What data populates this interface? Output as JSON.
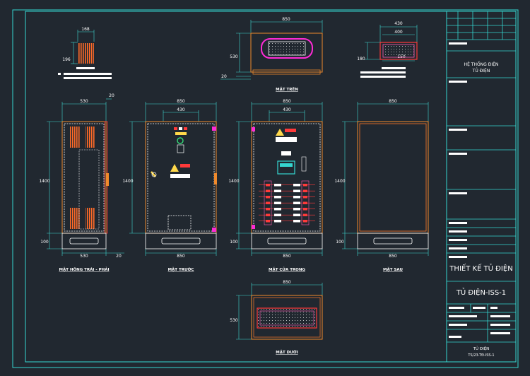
{
  "colors": {
    "background": "#212830",
    "frame": "#35d6d0",
    "dimension": "#3fd9d2",
    "cabinet": "#f08a2c",
    "panel": "#ff7a28",
    "red": "#ff3a3a",
    "magenta": "#ff2bd6",
    "white": "#ffffff",
    "yellow": "#ffd84a",
    "green": "#35e07a",
    "accent_pink": "#ff5fb3"
  },
  "views": {
    "side": {
      "title": "MẶT HÔNG TRÁI - PHẢI",
      "w_top": "530",
      "w_bottom": "530",
      "gap_top": "20",
      "gap_bottom": "20",
      "h": "1400",
      "base": "100"
    },
    "front": {
      "title": "MẶT TRƯỚC",
      "w": "850",
      "inner_w": "430",
      "w_bottom": "850",
      "h": "1400",
      "base": "100"
    },
    "inside": {
      "title": "MẶT CỬA TRONG",
      "w": "850",
      "inner_w": "430",
      "w_bottom": "850",
      "h": "1400",
      "base": "100"
    },
    "back": {
      "title": "MẶT SAU",
      "w": "850",
      "w_bottom": "850",
      "h": "1400",
      "base": "100"
    },
    "top": {
      "title": "MẶT TRÊN",
      "w": "850",
      "h": "530",
      "gap": "20"
    },
    "bottom": {
      "title": "MẶT DƯỚI",
      "w": "850",
      "h": "530"
    },
    "vent": {
      "w": "168",
      "h": "196"
    },
    "gland": {
      "w_outer": "430",
      "w_inner": "400",
      "h": "180",
      "w_mid": "150"
    }
  },
  "title_block": {
    "system": "HỆ THỐNG ĐIỆN",
    "cabinet": "TỦ ĐIỆN",
    "drawing_title": "THIẾT KẾ TỦ ĐIỆN",
    "drawing_name": "TỦ ĐIỆN-ISS-1",
    "footer_line1": "TỦ ĐIỆN",
    "footer_line2": "TS/23-TĐ-ISS-1"
  }
}
